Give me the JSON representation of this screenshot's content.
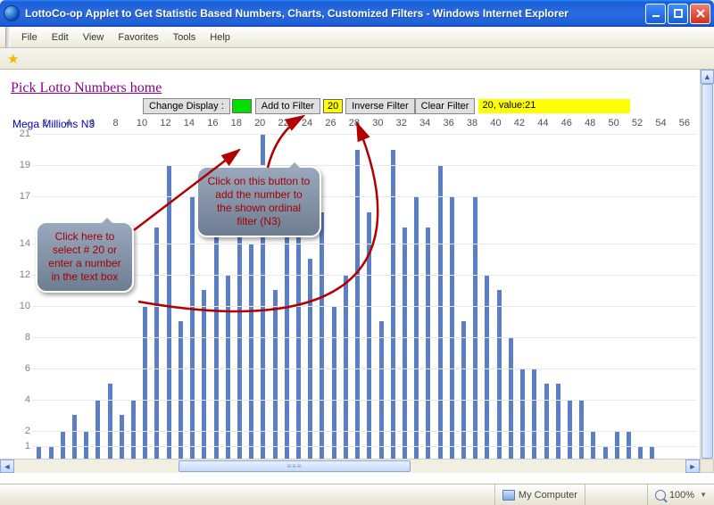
{
  "window": {
    "title": "LottoCo-op Applet to Get Statistic Based Numbers, Charts, Customized Filters - Windows Internet Explorer"
  },
  "menu": {
    "items": [
      "File",
      "Edit",
      "View",
      "Favorites",
      "Tools",
      "Help"
    ]
  },
  "page": {
    "home_link": "Pick Lotto Numbers home",
    "toolbar": {
      "change_display": "Change Display :",
      "add_to_filter": "Add to Filter",
      "textbox_value": "20",
      "inverse_filter": "Inverse Filter",
      "clear_filter": "Clear Filter",
      "status": "20, value:21"
    },
    "chart_title": "Mega Millions N3"
  },
  "callouts": {
    "c1": "Click here to select # 20 or enter a number in the text box",
    "c2": "Click on this button to add the number to the  shown ordinal filter (N3)"
  },
  "statusbar": {
    "zone": "My Computer",
    "zoom": "100%"
  },
  "chart_data": {
    "type": "bar",
    "title": "Mega Millions N3",
    "xlabel": "",
    "ylabel": "",
    "ylim": [
      0,
      21
    ],
    "y_ticks": [
      1,
      2,
      4,
      6,
      8,
      10,
      12,
      14,
      17,
      19,
      21
    ],
    "x_ticks": [
      2,
      4,
      6,
      8,
      10,
      12,
      14,
      16,
      18,
      20,
      22,
      24,
      26,
      28,
      30,
      32,
      34,
      36,
      38,
      40,
      42,
      44,
      46,
      48,
      50,
      52,
      54,
      56
    ],
    "categories": [
      1,
      2,
      3,
      4,
      5,
      6,
      7,
      8,
      9,
      10,
      11,
      12,
      13,
      14,
      15,
      16,
      17,
      18,
      19,
      20,
      21,
      22,
      23,
      24,
      25,
      26,
      27,
      28,
      29,
      30,
      31,
      32,
      33,
      34,
      35,
      36,
      37,
      38,
      39,
      40,
      41,
      42,
      43,
      44,
      45,
      46,
      47,
      48,
      49,
      50,
      51,
      52,
      53,
      54,
      55,
      56
    ],
    "values": [
      1,
      1,
      2,
      3,
      2,
      4,
      5,
      3,
      4,
      10,
      15,
      19,
      9,
      17,
      11,
      18,
      12,
      19,
      14,
      21,
      11,
      18,
      15,
      13,
      16,
      10,
      12,
      20,
      16,
      9,
      20,
      15,
      17,
      15,
      19,
      17,
      9,
      17,
      12,
      11,
      8,
      6,
      6,
      5,
      5,
      4,
      4,
      2,
      1,
      2,
      2,
      1,
      1,
      0,
      0,
      0
    ]
  }
}
